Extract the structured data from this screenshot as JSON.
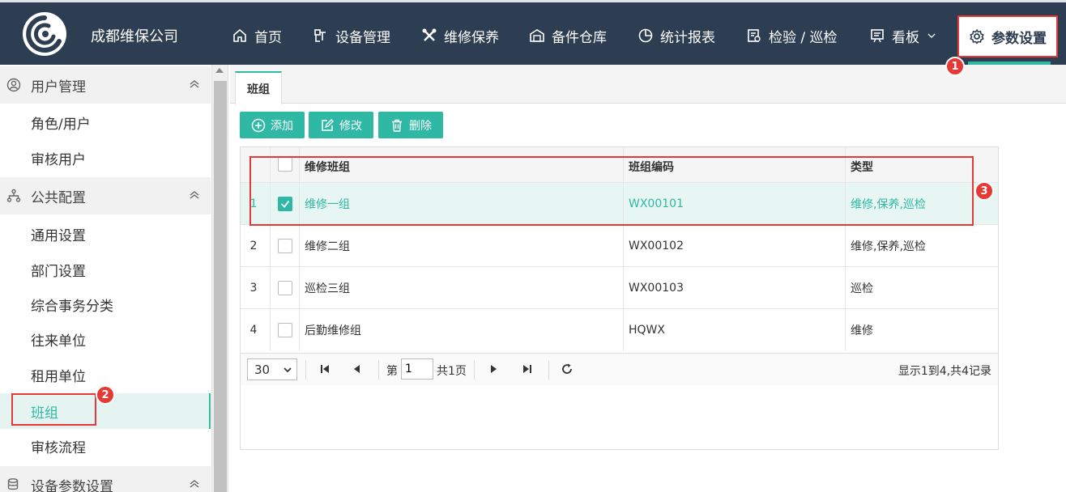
{
  "header": {
    "company": "成都维保公司",
    "nav": [
      {
        "label": "首页",
        "icon": "home-icon"
      },
      {
        "label": "设备管理",
        "icon": "equipment-icon"
      },
      {
        "label": "维修保养",
        "icon": "tools-icon"
      },
      {
        "label": "备件仓库",
        "icon": "warehouse-icon"
      },
      {
        "label": "统计报表",
        "icon": "chart-icon"
      },
      {
        "label": "检验 / 巡检",
        "icon": "inspection-icon"
      },
      {
        "label": "看板",
        "icon": "board-icon"
      },
      {
        "label": "参数设置",
        "icon": "gear-icon"
      }
    ],
    "active_index": 7
  },
  "badges": {
    "b1": "1",
    "b2": "2",
    "b3": "3"
  },
  "sidebar": {
    "groups": [
      {
        "label": "用户管理",
        "items": [
          "角色/用户",
          "审核用户"
        ]
      },
      {
        "label": "公共配置",
        "items": [
          "通用设置",
          "部门设置",
          "综合事务分类",
          "往来单位",
          "租用单位",
          "班组",
          "审核流程"
        ]
      },
      {
        "label": "设备参数设置",
        "items": []
      }
    ],
    "selected": "班组"
  },
  "tabs": [
    {
      "label": "班组"
    }
  ],
  "toolbar": {
    "add": "添加",
    "edit": "修改",
    "delete": "删除"
  },
  "table": {
    "columns": [
      "维修班组",
      "班组编码",
      "类型"
    ],
    "rows": [
      {
        "num": "1",
        "name": "维修一组",
        "code": "WX00101",
        "type": "维修,保养,巡检",
        "checked": true
      },
      {
        "num": "2",
        "name": "维修二组",
        "code": "WX00102",
        "type": "维修,保养,巡检",
        "checked": false
      },
      {
        "num": "3",
        "name": "巡检三组",
        "code": "WX00103",
        "type": "巡检",
        "checked": false
      },
      {
        "num": "4",
        "name": "后勤维修组",
        "code": "HQWX",
        "type": "维修",
        "checked": false
      }
    ]
  },
  "pager": {
    "page_size": "30",
    "page_prefix": "第",
    "page_value": "1",
    "page_suffix": "共1页",
    "info": "显示1到4,共4记录"
  },
  "colors": {
    "accent": "#2fb8a4",
    "header_bg": "#2e3e52",
    "highlight": "#e53935"
  }
}
